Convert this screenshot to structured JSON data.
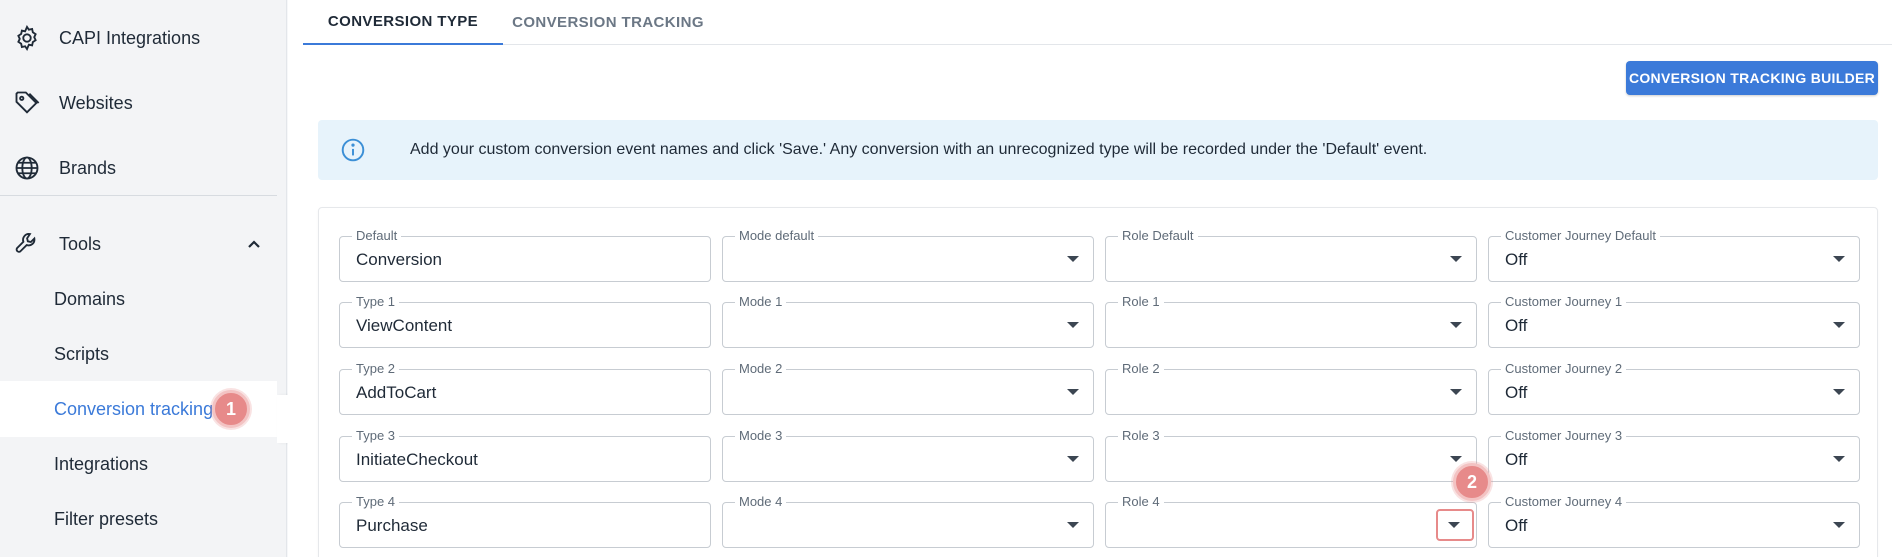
{
  "sidebar": {
    "items": [
      {
        "label": "CAPI Integrations",
        "icon": "gear-icon"
      },
      {
        "label": "Websites",
        "icon": "tag-icon"
      },
      {
        "label": "Brands",
        "icon": "globe-icon"
      }
    ],
    "tools": {
      "label": "Tools",
      "icon": "wrench-icon",
      "expanded": true
    },
    "sub_items": [
      {
        "label": "Domains"
      },
      {
        "label": "Scripts"
      },
      {
        "label": "Conversion tracking",
        "active": true,
        "badge": "1"
      },
      {
        "label": "Integrations"
      },
      {
        "label": "Filter presets"
      }
    ]
  },
  "tabs": [
    {
      "label": "CONVERSION TYPE",
      "active": true
    },
    {
      "label": "CONVERSION TRACKING",
      "active": false
    }
  ],
  "builder_button": "CONVERSION TRACKING BUILDER",
  "info": {
    "text": "Add your custom conversion event names and click 'Save.' Any conversion with an unrecognized type will be recorded under the 'Default' event."
  },
  "step_badge_2": "2",
  "rows": [
    {
      "type_label": "Default",
      "type_value": "Conversion",
      "mode_label": "Mode default",
      "mode_value": "",
      "role_label": "Role Default",
      "role_value": "",
      "journey_label": "Customer Journey Default",
      "journey_value": "Off"
    },
    {
      "type_label": "Type 1",
      "type_value": "ViewContent",
      "mode_label": "Mode 1",
      "mode_value": "",
      "role_label": "Role 1",
      "role_value": "",
      "journey_label": "Customer Journey 1",
      "journey_value": "Off"
    },
    {
      "type_label": "Type 2",
      "type_value": "AddToCart",
      "mode_label": "Mode 2",
      "mode_value": "",
      "role_label": "Role 2",
      "role_value": "",
      "journey_label": "Customer Journey 2",
      "journey_value": "Off"
    },
    {
      "type_label": "Type 3",
      "type_value": "InitiateCheckout",
      "mode_label": "Mode 3",
      "mode_value": "",
      "role_label": "Role 3",
      "role_value": "",
      "journey_label": "Customer Journey 3",
      "journey_value": "Off"
    },
    {
      "type_label": "Type 4",
      "type_value": "Purchase",
      "mode_label": "Mode 4",
      "mode_value": "",
      "role_label": "Role 4",
      "role_value": "",
      "journey_label": "Customer Journey 4",
      "journey_value": "Off"
    }
  ],
  "colors": {
    "accent": "#3b7ad9",
    "badge": "#e78a8a",
    "info_bg": "#e7f3fb"
  }
}
